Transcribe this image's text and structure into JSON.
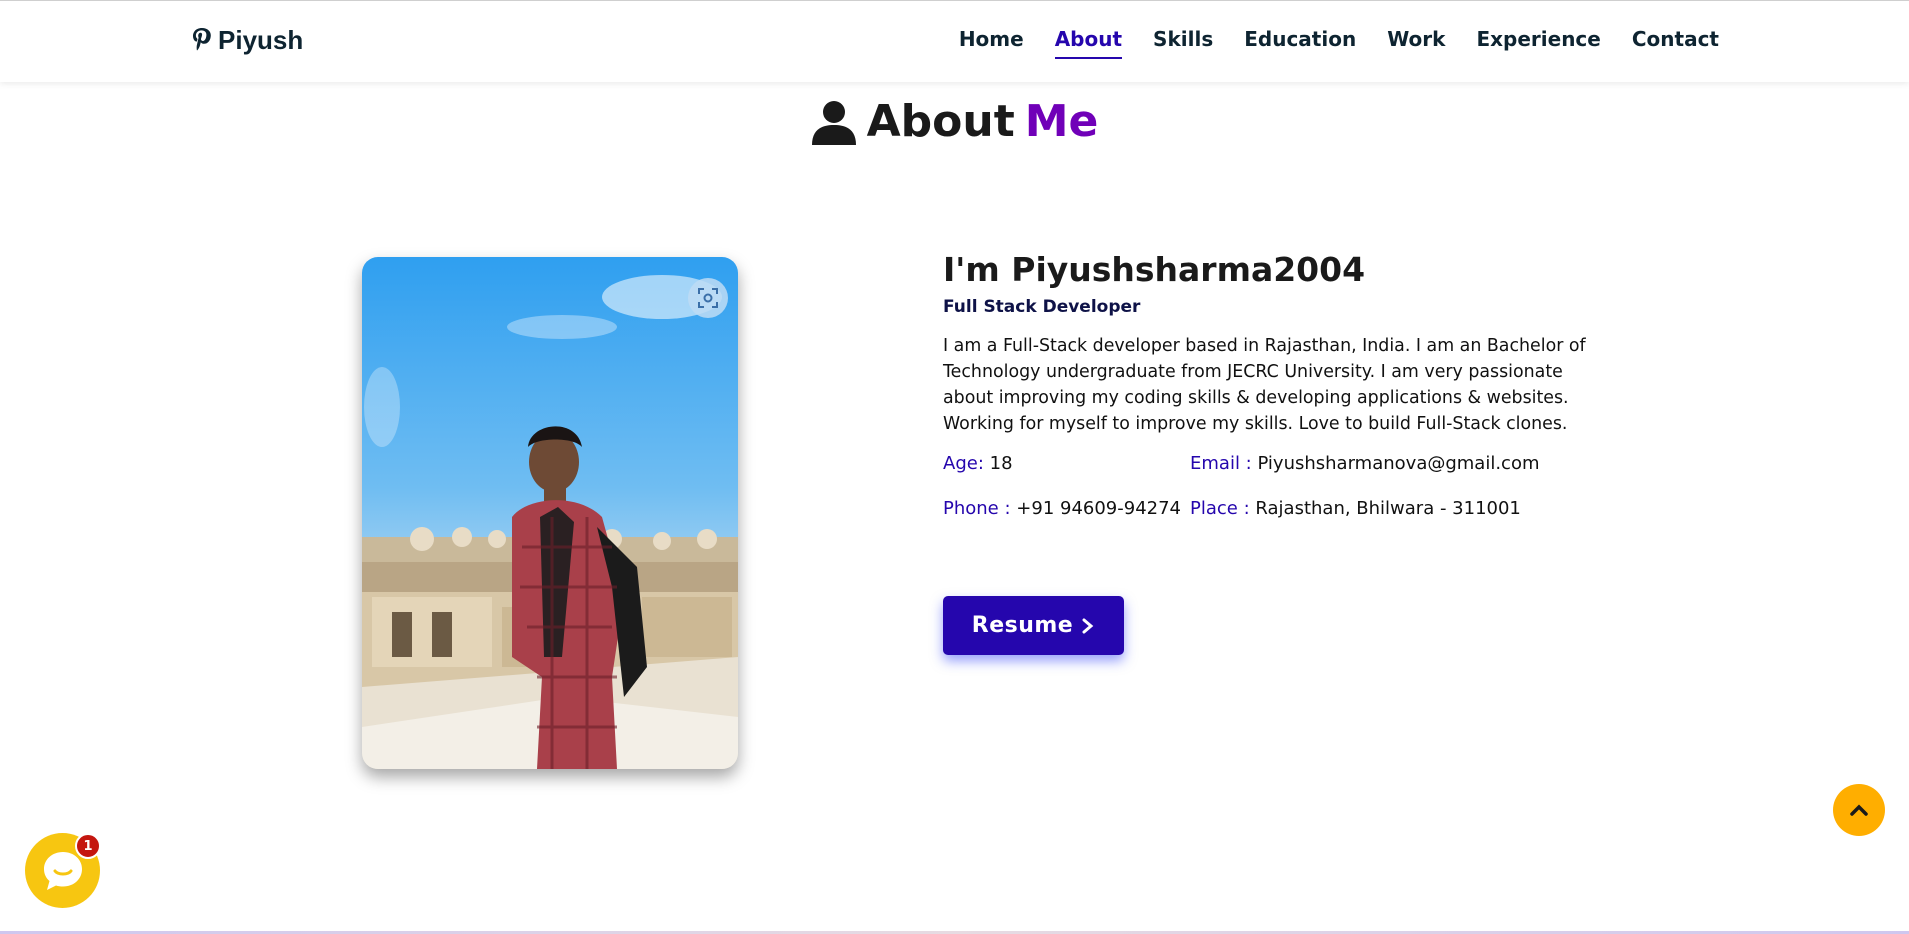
{
  "nav": {
    "brand": "Piyush",
    "links": [
      "Home",
      "About",
      "Skills",
      "Education",
      "Work",
      "Experience",
      "Contact"
    ],
    "active": "About"
  },
  "heading": {
    "text": "About",
    "accent": "Me"
  },
  "about": {
    "name": "I'm Piyushsharma2004",
    "role": "Full Stack Developer",
    "bio": "I am a Full-Stack developer based in Rajasthan, India. I am an Bachelor of Technology undergraduate from JECRC University. I am very passionate about improving my coding skills & developing applications & websites. Working for myself to improve my skills. Love to build Full-Stack clones.",
    "age_label": "Age:",
    "age_value": "18",
    "email_label": "Email :",
    "email_value": "Piyushsharmanova@gmail.com",
    "phone_label": "Phone :",
    "phone_value": "+91 94609-94274",
    "place_label": "Place :",
    "place_value": "Rajasthan, Bhilwara - 311001",
    "resume_label": "Resume"
  },
  "chat": {
    "badge": "1"
  },
  "colors": {
    "accent": "#2506ad",
    "heading_accent": "#7000b8",
    "scroll_top": "#ffae00",
    "chat": "#f7c611",
    "badge": "#c4160f"
  },
  "icons": {
    "brand": "pinterest-p-icon",
    "heading": "user-icon",
    "photo_overlay": "lens-scan-icon",
    "resume": "chevron-right-icon",
    "scroll_top": "chevron-up-icon",
    "chat": "chat-bubble-icon"
  }
}
